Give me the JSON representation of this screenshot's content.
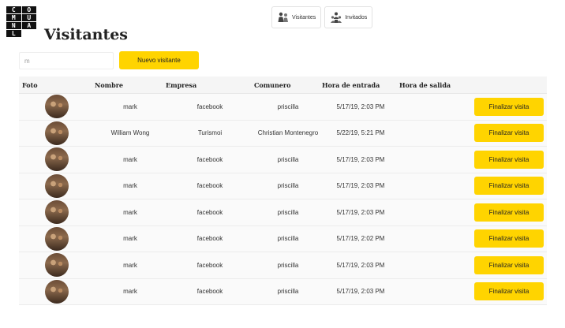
{
  "logo": {
    "letters": [
      "CO",
      "MU",
      "NAL"
    ]
  },
  "nav": {
    "items": [
      {
        "label": "Visitantes",
        "icon": "visitors-icon"
      },
      {
        "label": "Invitados",
        "icon": "guests-icon"
      }
    ]
  },
  "page": {
    "title": "Visitantes"
  },
  "search": {
    "value": "m",
    "placeholder": ""
  },
  "actions": {
    "new_visitor": "Nuevo visitante"
  },
  "table": {
    "headers": {
      "foto": "Foto",
      "nombre": "Nombre",
      "empresa": "Empresa",
      "comunero": "Comunero",
      "entrada": "Hora de entrada",
      "salida": "Hora de salida"
    },
    "finish_label": "Finalizar visita",
    "rows": [
      {
        "nombre": "mark",
        "empresa": "facebook",
        "comunero": "priscilla",
        "entrada": "5/17/19, 2:03 PM",
        "salida": ""
      },
      {
        "nombre": "William Wong",
        "empresa": "Turismoi",
        "comunero": "Christian Montenegro",
        "entrada": "5/22/19, 5:21 PM",
        "salida": ""
      },
      {
        "nombre": "mark",
        "empresa": "facebook",
        "comunero": "priscilla",
        "entrada": "5/17/19, 2:03 PM",
        "salida": ""
      },
      {
        "nombre": "mark",
        "empresa": "facebook",
        "comunero": "priscilla",
        "entrada": "5/17/19, 2:03 PM",
        "salida": ""
      },
      {
        "nombre": "mark",
        "empresa": "facebook",
        "comunero": "priscilla",
        "entrada": "5/17/19, 2:03 PM",
        "salida": ""
      },
      {
        "nombre": "mark",
        "empresa": "facebook",
        "comunero": "priscilla",
        "entrada": "5/17/19, 2:02 PM",
        "salida": ""
      },
      {
        "nombre": "mark",
        "empresa": "facebook",
        "comunero": "priscilla",
        "entrada": "5/17/19, 2:03 PM",
        "salida": ""
      },
      {
        "nombre": "mark",
        "empresa": "facebook",
        "comunero": "priscilla",
        "entrada": "5/17/19, 2:03 PM",
        "salida": ""
      }
    ]
  },
  "colors": {
    "accent": "#ffd400",
    "text": "#222222"
  }
}
